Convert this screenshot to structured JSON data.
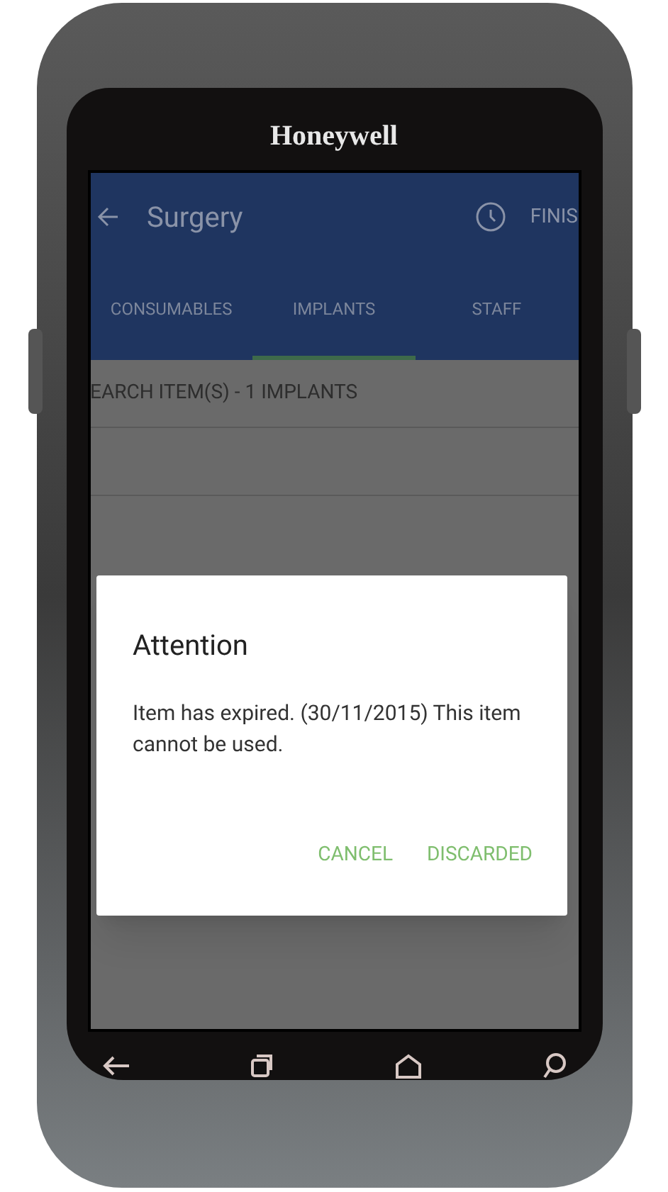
{
  "device": {
    "brand": "Honeywell"
  },
  "app_bar": {
    "title": "Surgery",
    "action": "FINIS"
  },
  "tabs": [
    {
      "label": "CONSUMABLES",
      "selected": false
    },
    {
      "label": "IMPLANTS",
      "selected": true
    },
    {
      "label": "STAFF",
      "selected": false
    }
  ],
  "list_header": "EARCH ITEM(S) - 1 IMPLANTS",
  "dialog": {
    "title": "Attention",
    "message": "Item has expired. (30/11/2015) This item cannot be used.",
    "buttons": [
      "CANCEL",
      "DISCARDED"
    ]
  }
}
